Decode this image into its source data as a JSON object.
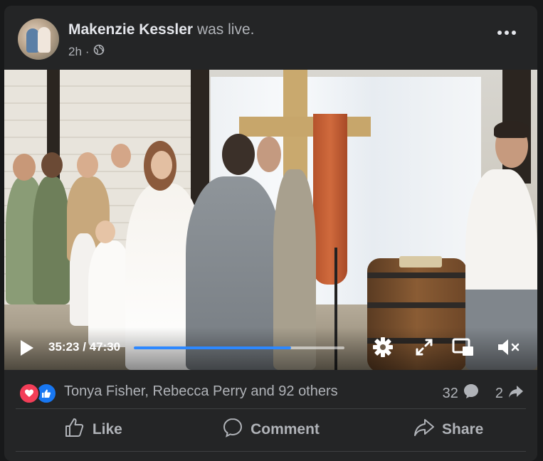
{
  "post": {
    "author": "Makenzie Kessler",
    "action_text": "was live.",
    "timestamp": "2h",
    "privacy_icon": "globe-icon"
  },
  "video": {
    "current_time": "35:23",
    "separator": " / ",
    "duration": "47:30",
    "progress": 0.745,
    "icons": [
      "play-icon",
      "settings-icon",
      "fullscreen-icon",
      "picture-in-picture-icon",
      "muted-speaker-icon"
    ]
  },
  "reactions": {
    "icons": [
      "love-icon",
      "like-icon"
    ],
    "names_text": "Tonya Fisher, Rebecca Perry and 92 others",
    "comments_count": "32",
    "shares_count": "2"
  },
  "actions": {
    "like_label": "Like",
    "comment_label": "Comment",
    "share_label": "Share"
  },
  "colors": {
    "background": "#18191a",
    "card": "#242526",
    "primary_text": "#e4e6eb",
    "secondary_text": "#b0b3b8",
    "progress_blue": "#2d88ff",
    "love_red": "#f33e58",
    "like_blue": "#1877f2"
  }
}
